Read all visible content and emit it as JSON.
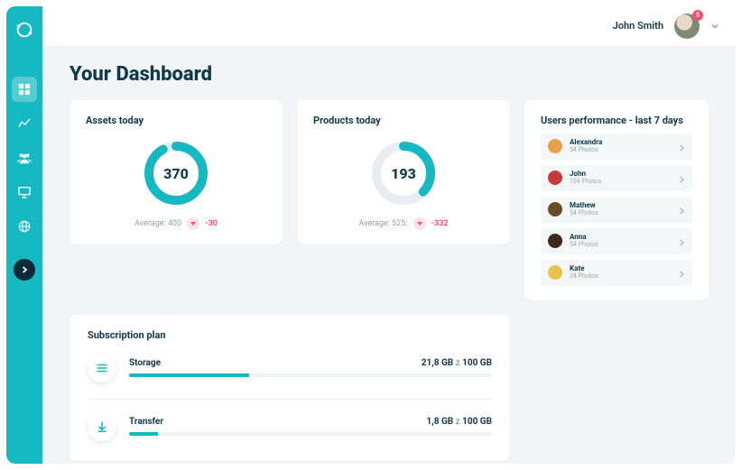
{
  "header": {
    "user_name": "John Smith",
    "badge_count": "5"
  },
  "page_title": "Your Dashboard",
  "gauges": {
    "assets": {
      "title": "Assets today",
      "value": "370",
      "avg_label": "Average: 400",
      "diff": "-30",
      "pct": 0.92
    },
    "products": {
      "title": "Products today",
      "value": "193",
      "avg_label": "Average: 525:",
      "diff": "-332",
      "pct": 0.37
    }
  },
  "performance": {
    "title": "Users performance - last 7 days",
    "items": [
      {
        "name": "Alexandra",
        "sub": "54 Photos",
        "color": "#e8a04a"
      },
      {
        "name": "John",
        "sub": "154 Photos",
        "color": "#c33b3b"
      },
      {
        "name": "Mathew",
        "sub": "54 Photos",
        "color": "#6b4a2b"
      },
      {
        "name": "Anna",
        "sub": "54 Photos",
        "color": "#3b2b1e"
      },
      {
        "name": "Kate",
        "sub": "34 Photos",
        "color": "#e8c24a"
      }
    ]
  },
  "subscription": {
    "title": "Subscription plan",
    "storage": {
      "label": "Storage",
      "used": "21,8 GB",
      "total": "100 GB",
      "sep": "z",
      "pct": 0.33
    },
    "transfer": {
      "label": "Transfer",
      "used": "1,8 GB",
      "total": "100 GB",
      "sep": "z",
      "pct": 0.08
    }
  }
}
